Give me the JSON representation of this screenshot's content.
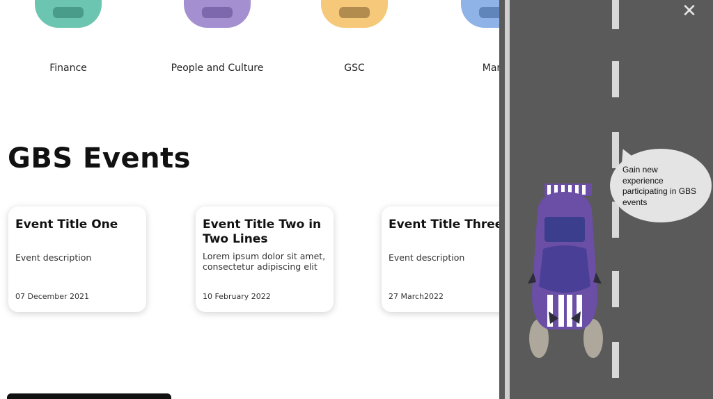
{
  "categories": [
    {
      "label": "Finance",
      "color": "#6cc5b0"
    },
    {
      "label": "People and Culture",
      "color": "#a48fd0"
    },
    {
      "label": "GSC",
      "color": "#f6c97a"
    },
    {
      "label": "Mark",
      "color": "#8fb3e6"
    }
  ],
  "events_section": {
    "title": "GBS Events",
    "cards": [
      {
        "title": "Event Title One",
        "description": "Event description",
        "date": "07 December 2021"
      },
      {
        "title": "Event Title Two in Two Lines",
        "description": "Lorem ipsum dolor sit amet, consectetur adipiscing elit",
        "date": "10 February 2022"
      },
      {
        "title": "Event Title Three",
        "description": "Event description",
        "date": "27 March2022"
      }
    ]
  },
  "overlay": {
    "close_icon": "close-icon",
    "bubble_text": "Gain new experience participating in GBS events",
    "colors": {
      "road": "#5a5a5a",
      "car": "#6b4ea6",
      "bubble": "#e4e4e4"
    }
  }
}
